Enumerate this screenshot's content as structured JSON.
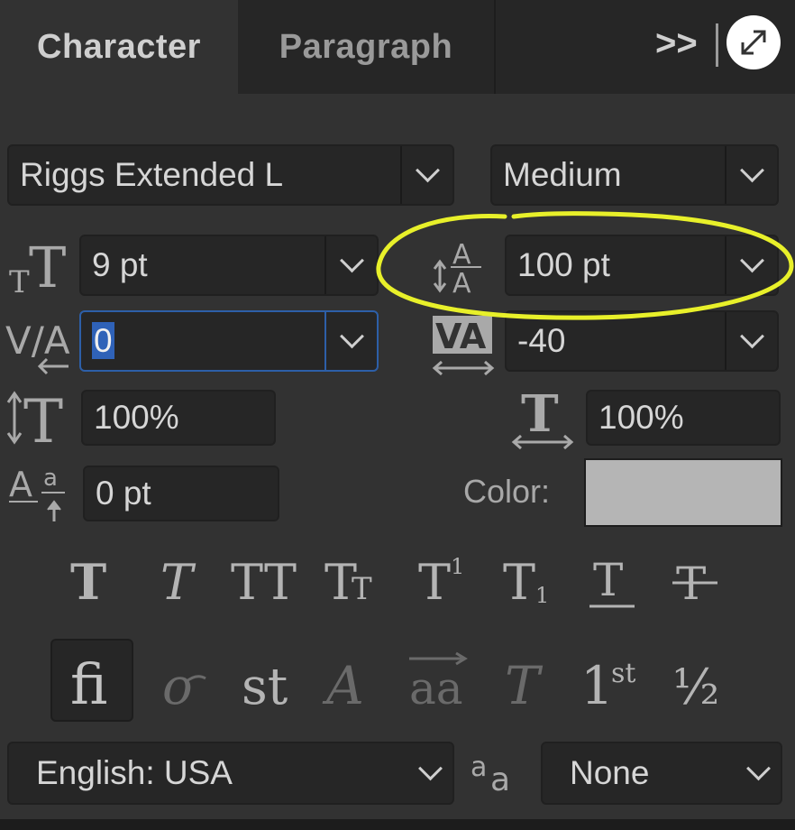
{
  "tabs": {
    "character": "Character",
    "paragraph": "Paragraph",
    "overflow": ">>"
  },
  "font": {
    "family": "Riggs Extended L",
    "style": "Medium"
  },
  "size": {
    "font_size": "9 pt",
    "leading": "100 pt"
  },
  "spacing": {
    "kerning": "0",
    "tracking": "-40"
  },
  "scale": {
    "vertical": "100%",
    "horizontal": "100%"
  },
  "baseline": {
    "shift": "0 pt"
  },
  "color": {
    "label": "Color:",
    "value": "#b5b5b5"
  },
  "ot_glyph_labels": {
    "ordinals": "st",
    "fraction": "½"
  },
  "footer": {
    "language": "English: USA",
    "antialias": "None"
  },
  "annotation": {
    "color": "#e8f02a",
    "target": "leading"
  }
}
